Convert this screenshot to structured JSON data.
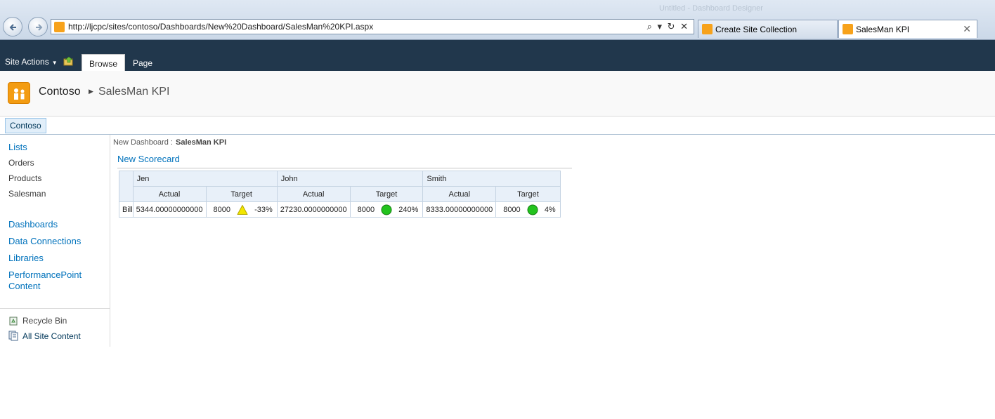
{
  "browser": {
    "window_title": "Untitled - Dashboard Designer",
    "url": "http://ljcpc/sites/contoso/Dashboards/New%20Dashboard/SalesMan%20KPI.aspx",
    "address_controls": "⌕ ▾ ↻ ✕",
    "tabs": [
      {
        "label": "Create Site Collection"
      },
      {
        "label": "SalesMan KPI",
        "close": "✕"
      }
    ]
  },
  "ribbon": {
    "site_actions": "Site Actions",
    "tabs": [
      {
        "label": "Browse"
      },
      {
        "label": "Page"
      }
    ]
  },
  "title_area": {
    "site": "Contoso",
    "page": "SalesMan KPI"
  },
  "top_nav": {
    "item": "Contoso"
  },
  "quick_launch": {
    "lists_heading": "Lists",
    "lists": [
      "Orders",
      "Products",
      "Salesman"
    ],
    "links": [
      "Dashboards",
      "Data Connections",
      "Libraries",
      "PerformancePoint",
      "Content"
    ],
    "recycle_bin": "Recycle Bin",
    "all_site_content": "All Site Content"
  },
  "main": {
    "breadcrumb_parent": "New Dashboard :",
    "breadcrumb_current": "SalesMan KPI",
    "scorecard_title": "New Scorecard"
  },
  "scorecard": {
    "columns": [
      {
        "name": "Jen",
        "actual_label": "Actual",
        "target_label": "Target"
      },
      {
        "name": "John",
        "actual_label": "Actual",
        "target_label": "Target"
      },
      {
        "name": "Smith",
        "actual_label": "Actual",
        "target_label": "Target"
      }
    ],
    "rows": [
      {
        "label": "Bill",
        "cells": [
          {
            "actual": "5344.00000000000",
            "target": "8000",
            "indicator": "warning-triangle-icon",
            "indicator_color": "#f2e600",
            "pct": "-33%"
          },
          {
            "actual": "27230.0000000000",
            "target": "8000",
            "indicator": "green-circle-icon",
            "indicator_color": "#22c31e",
            "pct": "240%"
          },
          {
            "actual": "8333.00000000000",
            "target": "8000",
            "indicator": "green-circle-icon",
            "indicator_color": "#22c31e",
            "pct": "4%"
          }
        ]
      }
    ]
  },
  "colors": {
    "ribbon_bg": "#21374c",
    "link_blue": "#0072bc",
    "header_bg": "#e8f0f9"
  }
}
